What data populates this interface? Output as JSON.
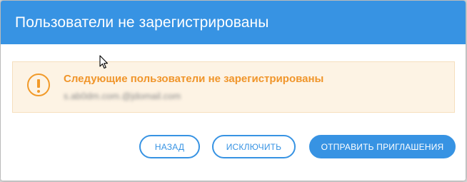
{
  "dialog": {
    "title": "Пользователи не зарегистрированы",
    "header_color": "#3793e3"
  },
  "alert": {
    "icon": "exclamation-circle-icon",
    "title": "Следующие пользователи не зарегистрированы",
    "email": "s.ab0dm.com.@jdomail.com",
    "accent_color": "#f0952a",
    "background_color": "#fdf3e4"
  },
  "buttons": {
    "back_label": "НАЗАД",
    "exclude_label": "ИСКЛЮЧИТЬ",
    "invite_label": "ОТПРАВИТЬ ПРИГЛАШЕНИЯ"
  }
}
